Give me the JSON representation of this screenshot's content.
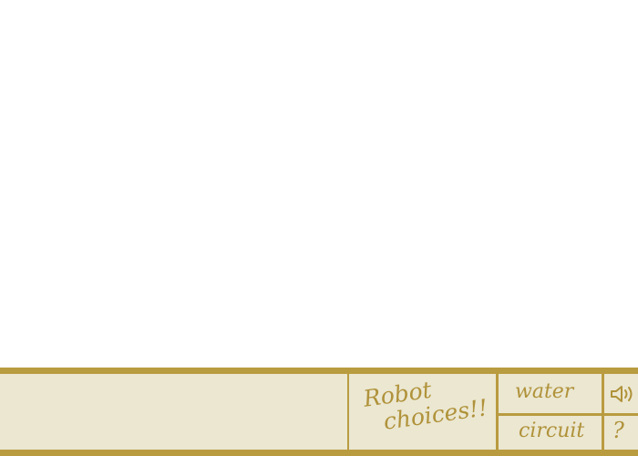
{
  "toolbar": {
    "robot_choices": {
      "line1": "Robot",
      "line2": "choices!!"
    },
    "water_label": "water",
    "circuit_label": "circuit",
    "help_label": "?",
    "sound_icon": "speaker-icon"
  },
  "colors": {
    "accent": "#b99b40",
    "panel": "#ebe7d1",
    "background": "#ffffff"
  }
}
